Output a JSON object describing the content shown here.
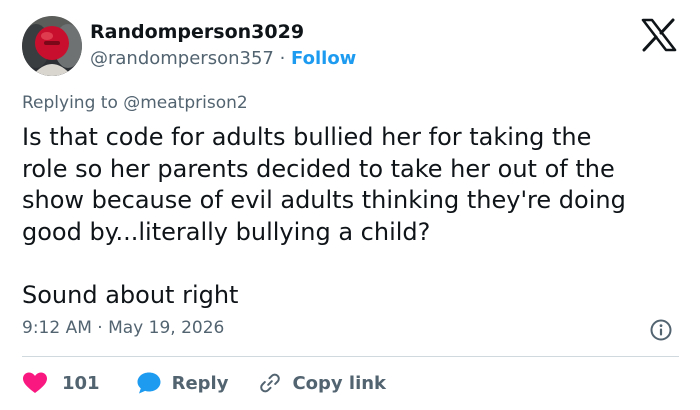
{
  "user": {
    "display_name": "Randomperson3029",
    "handle": "@randomperson357",
    "separator": " · ",
    "follow_label": "Follow"
  },
  "reply_context": "Replying to @meatprison2",
  "tweet": {
    "lines": [
      "Is that code for adults bullied her for taking the",
      "role so her parents decided to take her out of the",
      "show because of evil adults thinking they're doing",
      "good by...literally bullying a child?"
    ],
    "closing_line": "Sound about right"
  },
  "timestamp": "9:12 AM · May 19, 2026",
  "actions": {
    "like_count": "101",
    "reply_label": "Reply",
    "copy_label": "Copy link"
  },
  "icons": {
    "logo": "x-logo-icon",
    "like": "heart-icon",
    "reply": "speech-bubble-icon",
    "copy": "link-icon",
    "info": "info-icon"
  },
  "colors": {
    "text_primary": "#0f1419",
    "text_secondary": "#536471",
    "link": "#1d9bf0",
    "like": "#f91880",
    "divider": "#cfd9de"
  }
}
